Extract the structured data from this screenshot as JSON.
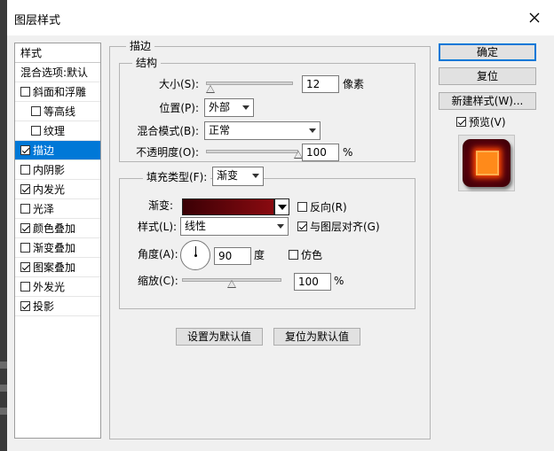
{
  "window": {
    "title": "图层样式"
  },
  "style_list": {
    "header": "样式",
    "items": [
      {
        "label": "混合选项:默认",
        "checkbox": false,
        "checked": false,
        "selected": false,
        "indent": false
      },
      {
        "label": "斜面和浮雕",
        "checkbox": true,
        "checked": false,
        "selected": false,
        "indent": false
      },
      {
        "label": "等高线",
        "checkbox": true,
        "checked": false,
        "selected": false,
        "indent": true
      },
      {
        "label": "纹理",
        "checkbox": true,
        "checked": false,
        "selected": false,
        "indent": true
      },
      {
        "label": "描边",
        "checkbox": true,
        "checked": true,
        "selected": true,
        "indent": false
      },
      {
        "label": "内阴影",
        "checkbox": true,
        "checked": false,
        "selected": false,
        "indent": false
      },
      {
        "label": "内发光",
        "checkbox": true,
        "checked": true,
        "selected": false,
        "indent": false
      },
      {
        "label": "光泽",
        "checkbox": true,
        "checked": false,
        "selected": false,
        "indent": false
      },
      {
        "label": "颜色叠加",
        "checkbox": true,
        "checked": true,
        "selected": false,
        "indent": false
      },
      {
        "label": "渐变叠加",
        "checkbox": true,
        "checked": false,
        "selected": false,
        "indent": false
      },
      {
        "label": "图案叠加",
        "checkbox": true,
        "checked": true,
        "selected": false,
        "indent": false
      },
      {
        "label": "外发光",
        "checkbox": true,
        "checked": false,
        "selected": false,
        "indent": false
      },
      {
        "label": "投影",
        "checkbox": true,
        "checked": true,
        "selected": false,
        "indent": false
      }
    ]
  },
  "stroke": {
    "section_title": "描边",
    "structure_title": "结构",
    "size": {
      "label": "大小(S):",
      "value": "12",
      "unit": "像素",
      "slider": 0.05
    },
    "position": {
      "label": "位置(P):",
      "value": "外部"
    },
    "blend_mode": {
      "label": "混合模式(B):",
      "value": "正常"
    },
    "opacity": {
      "label": "不透明度(O):",
      "value": "100",
      "unit": "%",
      "slider": 1.0
    },
    "fill_type": {
      "label": "填充类型(F):",
      "value": "渐变"
    },
    "gradient": {
      "label": "渐变:",
      "colors": [
        "#3a0005",
        "#8a0a10"
      ]
    },
    "reverse": {
      "label": "反向(R)",
      "checked": false
    },
    "style": {
      "label": "样式(L):",
      "value": "线性"
    },
    "align_layer": {
      "label": "与图层对齐(G)",
      "checked": true
    },
    "angle": {
      "label": "角度(A):",
      "value": "90",
      "unit": "度"
    },
    "dither": {
      "label": "仿色",
      "checked": false
    },
    "scale": {
      "label": "缩放(C):",
      "value": "100",
      "unit": "%",
      "slider": 0.5
    }
  },
  "buttons": {
    "set_default": "设置为默认值",
    "reset_default": "复位为默认值",
    "ok": "确定",
    "reset": "复位",
    "new_style": "新建样式(W)...",
    "preview": {
      "label": "预览(V)",
      "checked": true
    }
  },
  "colors": {
    "accent": "#0078d7",
    "list_selected": "#0078d7"
  }
}
